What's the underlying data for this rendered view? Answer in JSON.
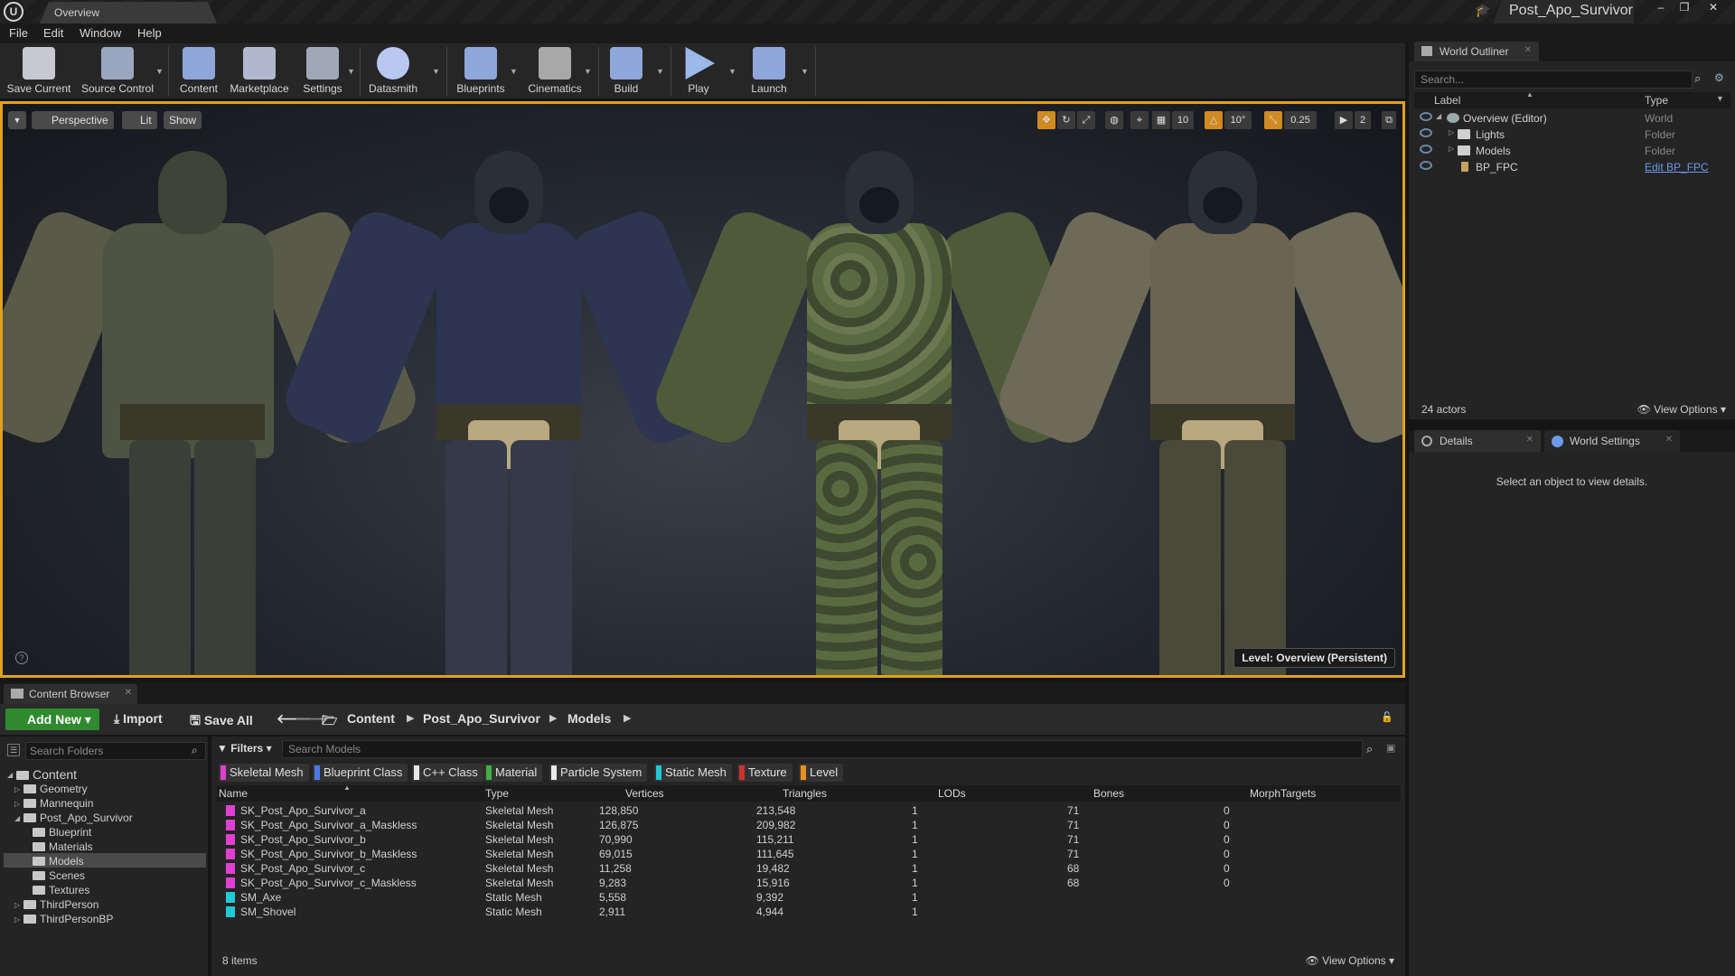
{
  "titlebar": {
    "logo": "U",
    "document_tab": "Overview",
    "project_name": "Post_Apo_Survivor",
    "project_icon": "graduation-cap-icon",
    "controls": [
      "–",
      "❐",
      "✕"
    ]
  },
  "menu": [
    "File",
    "Edit",
    "Window",
    "Help"
  ],
  "toolbar": {
    "buttons": [
      {
        "label": "Save Current",
        "icon": "save-icon",
        "color": "#c8c8d0"
      },
      {
        "label": "Source Control",
        "icon": "source-control-icon",
        "color": "#9aa6c0"
      },
      {
        "label": "Content",
        "icon": "content-icon",
        "color": "#8ea6d8"
      },
      {
        "label": "Marketplace",
        "icon": "marketplace-icon",
        "color": "#b0b8d0"
      },
      {
        "label": "Settings",
        "icon": "settings-icon",
        "color": "#a0a8b8"
      },
      {
        "label": "Datasmith",
        "icon": "datasmith-icon",
        "color": "#b8c8f0"
      },
      {
        "label": "Blueprints",
        "icon": "blueprints-icon",
        "color": "#8ea6d8"
      },
      {
        "label": "Cinematics",
        "icon": "cinematics-icon",
        "color": "#a8a8a8"
      },
      {
        "label": "Build",
        "icon": "build-icon",
        "color": "#8ea6d8"
      },
      {
        "label": "Play",
        "icon": "play-icon",
        "color": "#9ab8e8"
      },
      {
        "label": "Launch",
        "icon": "launch-icon",
        "color": "#8ea6d8"
      }
    ],
    "dropdown_glyph": "▼"
  },
  "viewport": {
    "menu_glyph": "▼",
    "perspective": "Perspective",
    "lit": "Lit",
    "show": "Show",
    "grid_snap": "10",
    "rotation_snap": "10°",
    "scale_snap": "0.25",
    "camera_speed": "2",
    "level": "Level:  Overview (Persistent)",
    "help_glyph": "?",
    "accent": "#e0a020"
  },
  "content_browser": {
    "tab": "Content Browser",
    "add_new": "Add New",
    "import": "Import",
    "save_all": "Save All",
    "breadcrumb": [
      "Content",
      "Post_Apo_Survivor",
      "Models"
    ],
    "folder_search_placeholder": "Search Folders",
    "asset_search_placeholder": "Search Models",
    "filters": "Filters",
    "filter_chips": [
      {
        "label": "Skeletal Mesh",
        "color": "#e040d0"
      },
      {
        "label": "Blueprint Class",
        "color": "#4a7ae8"
      },
      {
        "label": "C++ Class",
        "color": "#e8e8e8"
      },
      {
        "label": "Material",
        "color": "#40b040"
      },
      {
        "label": "Particle System",
        "color": "#e8e8e8"
      },
      {
        "label": "Static Mesh",
        "color": "#20c8d8"
      },
      {
        "label": "Texture",
        "color": "#d03030"
      },
      {
        "label": "Level",
        "color": "#e89020"
      }
    ],
    "tree": [
      {
        "label": "Content",
        "depth": 0,
        "expanded": true
      },
      {
        "label": "Geometry",
        "depth": 1
      },
      {
        "label": "Mannequin",
        "depth": 1
      },
      {
        "label": "Post_Apo_Survivor",
        "depth": 1,
        "expanded": true
      },
      {
        "label": "Blueprint",
        "depth": 2
      },
      {
        "label": "Materials",
        "depth": 2
      },
      {
        "label": "Models",
        "depth": 2,
        "selected": true
      },
      {
        "label": "Scenes",
        "depth": 2
      },
      {
        "label": "Textures",
        "depth": 2
      },
      {
        "label": "ThirdPerson",
        "depth": 1
      },
      {
        "label": "ThirdPersonBP",
        "depth": 1
      }
    ],
    "columns": [
      "Name",
      "Type",
      "Vertices",
      "Triangles",
      "LODs",
      "Bones",
      "MorphTargets"
    ],
    "rows": [
      {
        "name": "SK_Post_Apo_Survivor_a",
        "type": "Skeletal Mesh",
        "vertices": "128,850",
        "triangles": "213,548",
        "lods": "1",
        "bones": "71",
        "morph": "0",
        "color": "#e040d0"
      },
      {
        "name": "SK_Post_Apo_Survivor_a_Maskless",
        "type": "Skeletal Mesh",
        "vertices": "126,875",
        "triangles": "209,982",
        "lods": "1",
        "bones": "71",
        "morph": "0",
        "color": "#e040d0"
      },
      {
        "name": "SK_Post_Apo_Survivor_b",
        "type": "Skeletal Mesh",
        "vertices": "70,990",
        "triangles": "115,211",
        "lods": "1",
        "bones": "71",
        "morph": "0",
        "color": "#e040d0"
      },
      {
        "name": "SK_Post_Apo_Survivor_b_Maskless",
        "type": "Skeletal Mesh",
        "vertices": "69,015",
        "triangles": "111,645",
        "lods": "1",
        "bones": "71",
        "morph": "0",
        "color": "#e040d0"
      },
      {
        "name": "SK_Post_Apo_Survivor_c",
        "type": "Skeletal Mesh",
        "vertices": "11,258",
        "triangles": "19,482",
        "lods": "1",
        "bones": "68",
        "morph": "0",
        "color": "#e040d0"
      },
      {
        "name": "SK_Post_Apo_Survivor_c_Maskless",
        "type": "Skeletal Mesh",
        "vertices": "9,283",
        "triangles": "15,916",
        "lods": "1",
        "bones": "68",
        "morph": "0",
        "color": "#e040d0"
      },
      {
        "name": "SM_Axe",
        "type": "Static Mesh",
        "vertices": "5,558",
        "triangles": "9,392",
        "lods": "1",
        "bones": "",
        "morph": "",
        "color": "#20c8d8"
      },
      {
        "name": "SM_Shovel",
        "type": "Static Mesh",
        "vertices": "2,911",
        "triangles": "4,944",
        "lods": "1",
        "bones": "",
        "morph": "",
        "color": "#20c8d8"
      }
    ],
    "items_count": "8 items",
    "view_options": "View Options"
  },
  "outliner": {
    "tab": "World Outliner",
    "search_placeholder": "Search...",
    "col_label": "Label",
    "col_type": "Type",
    "rows": [
      {
        "label": "Overview (Editor)",
        "type": "World",
        "indent": 0
      },
      {
        "label": "Lights",
        "type": "Folder",
        "indent": 1
      },
      {
        "label": "Models",
        "type": "Folder",
        "indent": 1
      },
      {
        "label": "BP_FPC",
        "type": "Edit BP_FPC",
        "indent": 1,
        "link": true
      }
    ],
    "actors": "24 actors",
    "view_options": "View Options"
  },
  "details": {
    "tab_details": "Details",
    "tab_world_settings": "World Settings",
    "message": "Select an object to view details."
  }
}
